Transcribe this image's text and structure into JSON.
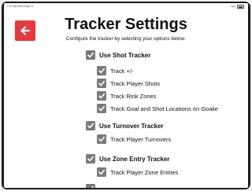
{
  "status_bar": {
    "time": "7:47 AM  Wed Aug 13",
    "battery": "74%"
  },
  "page": {
    "title": "Tracker Settings",
    "subtitle": "Configure the tracker by selecting your options below:"
  },
  "back_icon": "arrow-left-icon",
  "accent_color": "#e8383f",
  "checkbox_color": "#7a7a7a",
  "settings": {
    "shot_tracker": {
      "label": "Use Shot Tracker",
      "checked": true,
      "options": [
        {
          "label": "Track +/-",
          "checked": true
        },
        {
          "label": "Track Player Shots",
          "checked": true
        },
        {
          "label": "Track Rink Zones",
          "checked": true
        },
        {
          "label": "Track Goal and Shot Locations on Goalie",
          "checked": true
        }
      ]
    },
    "turnover_tracker": {
      "label": "Use Turnover Tracker",
      "checked": true,
      "options": [
        {
          "label": "Track Player Turnovers",
          "checked": true
        }
      ]
    },
    "zone_entry_tracker": {
      "label": "Use Zone Entry Tracker",
      "checked": true,
      "options": [
        {
          "label": "Track Player Zone Entries",
          "checked": true
        }
      ]
    }
  }
}
